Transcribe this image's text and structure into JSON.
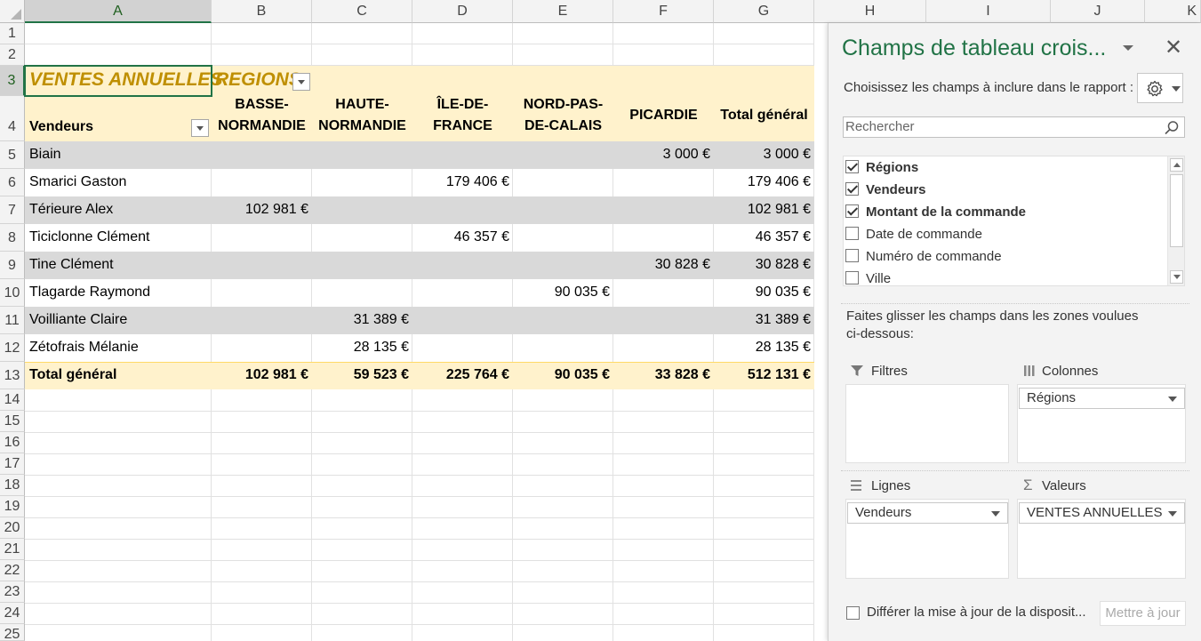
{
  "sheet": {
    "columns": [
      "A",
      "B",
      "C",
      "D",
      "E",
      "F",
      "G",
      "H",
      "I",
      "J",
      "K"
    ],
    "rows": [
      "1",
      "2",
      "3",
      "4",
      "5",
      "6",
      "7",
      "8",
      "9",
      "10",
      "11",
      "12",
      "13",
      "14",
      "15",
      "16",
      "17",
      "18",
      "19",
      "20",
      "21",
      "22",
      "23",
      "24",
      "25"
    ],
    "active_cell": "A3"
  },
  "pivot": {
    "values_caption": "VENTES ANNUELLES",
    "columns_caption": "REGIONS",
    "row_label": "Vendeurs",
    "column_headers": [
      {
        "line1": "BASSE-",
        "line2": "NORMANDIE"
      },
      {
        "line1": "HAUTE-",
        "line2": "NORMANDIE"
      },
      {
        "line1": "ÎLE-DE-",
        "line2": "FRANCE"
      },
      {
        "line1": "NORD-PAS-",
        "line2": "DE-CALAIS"
      },
      {
        "line1": "",
        "line2": "PICARDIE"
      },
      {
        "line1": "",
        "line2": "Total général"
      }
    ],
    "rows": [
      {
        "name": "Biain",
        "values": [
          "",
          "",
          "",
          "",
          "3 000 €",
          "3 000 €"
        ]
      },
      {
        "name": "Smarici Gaston",
        "values": [
          "",
          "",
          "179 406 €",
          "",
          "",
          "179 406 €"
        ]
      },
      {
        "name": "Térieure Alex",
        "values": [
          "102 981 €",
          "",
          "",
          "",
          "",
          "102 981 €"
        ]
      },
      {
        "name": "Ticiclonne Clément",
        "values": [
          "",
          "",
          "46 357 €",
          "",
          "",
          "46 357 €"
        ]
      },
      {
        "name": "Tine Clément",
        "values": [
          "",
          "",
          "",
          "",
          "30 828 €",
          "30 828 €"
        ]
      },
      {
        "name": "Tlagarde Raymond",
        "values": [
          "",
          "",
          "",
          "90 035 €",
          "",
          "90 035 €"
        ]
      },
      {
        "name": "Voilliante Claire",
        "values": [
          "",
          "31 389 €",
          "",
          "",
          "",
          "31 389 €"
        ]
      },
      {
        "name": "Zétofrais Mélanie",
        "values": [
          "",
          "28 135 €",
          "",
          "",
          "",
          "28 135 €"
        ]
      }
    ],
    "total": {
      "name": "Total général",
      "values": [
        "102 981 €",
        "59 523 €",
        "225 764 €",
        "90 035 €",
        "33 828 €",
        "512 131 €"
      ]
    },
    "colors": {
      "accent_text": "#bf8f00",
      "header_fill": "#fff2cc",
      "band_fill": "#d9d9d9"
    }
  },
  "pane": {
    "title": "Champs de tableau crois...",
    "close": "✕",
    "subtitle": "Choisissez les champs à inclure dans le rapport :",
    "search_placeholder": "Rechercher",
    "fields": [
      {
        "label": "Régions",
        "checked": true
      },
      {
        "label": "Vendeurs",
        "checked": true
      },
      {
        "label": "Montant de la commande",
        "checked": true
      },
      {
        "label": "Date de commande",
        "checked": false
      },
      {
        "label": "Numéro de commande",
        "checked": false
      },
      {
        "label": "Ville",
        "checked": false
      }
    ],
    "drag_hint": "Faites glisser les champs dans les zones voulues ci-dessous:",
    "zones": {
      "filters": {
        "title": "Filtres",
        "item": ""
      },
      "columns": {
        "title": "Colonnes",
        "item": "Régions"
      },
      "rows": {
        "title": "Lignes",
        "item": "Vendeurs"
      },
      "values": {
        "title": "Valeurs",
        "item": "VENTES ANNUELLES"
      }
    },
    "defer_label": "Différer la mise à jour de la disposit...",
    "update_button": "Mettre à jour",
    "accent": "#217346"
  }
}
